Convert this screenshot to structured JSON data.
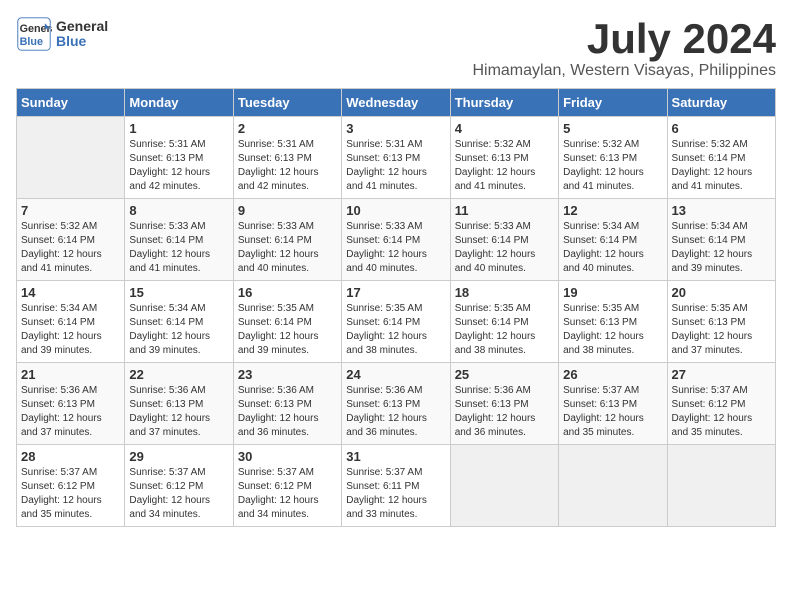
{
  "logo": {
    "line1": "General",
    "line2": "Blue"
  },
  "title": "July 2024",
  "subtitle": "Himamaylan, Western Visayas, Philippines",
  "days_header": [
    "Sunday",
    "Monday",
    "Tuesday",
    "Wednesday",
    "Thursday",
    "Friday",
    "Saturday"
  ],
  "weeks": [
    [
      {
        "day": "",
        "sunrise": "",
        "sunset": "",
        "daylight": ""
      },
      {
        "day": "1",
        "sunrise": "Sunrise: 5:31 AM",
        "sunset": "Sunset: 6:13 PM",
        "daylight": "Daylight: 12 hours and 42 minutes."
      },
      {
        "day": "2",
        "sunrise": "Sunrise: 5:31 AM",
        "sunset": "Sunset: 6:13 PM",
        "daylight": "Daylight: 12 hours and 42 minutes."
      },
      {
        "day": "3",
        "sunrise": "Sunrise: 5:31 AM",
        "sunset": "Sunset: 6:13 PM",
        "daylight": "Daylight: 12 hours and 41 minutes."
      },
      {
        "day": "4",
        "sunrise": "Sunrise: 5:32 AM",
        "sunset": "Sunset: 6:13 PM",
        "daylight": "Daylight: 12 hours and 41 minutes."
      },
      {
        "day": "5",
        "sunrise": "Sunrise: 5:32 AM",
        "sunset": "Sunset: 6:13 PM",
        "daylight": "Daylight: 12 hours and 41 minutes."
      },
      {
        "day": "6",
        "sunrise": "Sunrise: 5:32 AM",
        "sunset": "Sunset: 6:14 PM",
        "daylight": "Daylight: 12 hours and 41 minutes."
      }
    ],
    [
      {
        "day": "7",
        "sunrise": "Sunrise: 5:32 AM",
        "sunset": "Sunset: 6:14 PM",
        "daylight": "Daylight: 12 hours and 41 minutes."
      },
      {
        "day": "8",
        "sunrise": "Sunrise: 5:33 AM",
        "sunset": "Sunset: 6:14 PM",
        "daylight": "Daylight: 12 hours and 41 minutes."
      },
      {
        "day": "9",
        "sunrise": "Sunrise: 5:33 AM",
        "sunset": "Sunset: 6:14 PM",
        "daylight": "Daylight: 12 hours and 40 minutes."
      },
      {
        "day": "10",
        "sunrise": "Sunrise: 5:33 AM",
        "sunset": "Sunset: 6:14 PM",
        "daylight": "Daylight: 12 hours and 40 minutes."
      },
      {
        "day": "11",
        "sunrise": "Sunrise: 5:33 AM",
        "sunset": "Sunset: 6:14 PM",
        "daylight": "Daylight: 12 hours and 40 minutes."
      },
      {
        "day": "12",
        "sunrise": "Sunrise: 5:34 AM",
        "sunset": "Sunset: 6:14 PM",
        "daylight": "Daylight: 12 hours and 40 minutes."
      },
      {
        "day": "13",
        "sunrise": "Sunrise: 5:34 AM",
        "sunset": "Sunset: 6:14 PM",
        "daylight": "Daylight: 12 hours and 39 minutes."
      }
    ],
    [
      {
        "day": "14",
        "sunrise": "Sunrise: 5:34 AM",
        "sunset": "Sunset: 6:14 PM",
        "daylight": "Daylight: 12 hours and 39 minutes."
      },
      {
        "day": "15",
        "sunrise": "Sunrise: 5:34 AM",
        "sunset": "Sunset: 6:14 PM",
        "daylight": "Daylight: 12 hours and 39 minutes."
      },
      {
        "day": "16",
        "sunrise": "Sunrise: 5:35 AM",
        "sunset": "Sunset: 6:14 PM",
        "daylight": "Daylight: 12 hours and 39 minutes."
      },
      {
        "day": "17",
        "sunrise": "Sunrise: 5:35 AM",
        "sunset": "Sunset: 6:14 PM",
        "daylight": "Daylight: 12 hours and 38 minutes."
      },
      {
        "day": "18",
        "sunrise": "Sunrise: 5:35 AM",
        "sunset": "Sunset: 6:14 PM",
        "daylight": "Daylight: 12 hours and 38 minutes."
      },
      {
        "day": "19",
        "sunrise": "Sunrise: 5:35 AM",
        "sunset": "Sunset: 6:13 PM",
        "daylight": "Daylight: 12 hours and 38 minutes."
      },
      {
        "day": "20",
        "sunrise": "Sunrise: 5:35 AM",
        "sunset": "Sunset: 6:13 PM",
        "daylight": "Daylight: 12 hours and 37 minutes."
      }
    ],
    [
      {
        "day": "21",
        "sunrise": "Sunrise: 5:36 AM",
        "sunset": "Sunset: 6:13 PM",
        "daylight": "Daylight: 12 hours and 37 minutes."
      },
      {
        "day": "22",
        "sunrise": "Sunrise: 5:36 AM",
        "sunset": "Sunset: 6:13 PM",
        "daylight": "Daylight: 12 hours and 37 minutes."
      },
      {
        "day": "23",
        "sunrise": "Sunrise: 5:36 AM",
        "sunset": "Sunset: 6:13 PM",
        "daylight": "Daylight: 12 hours and 36 minutes."
      },
      {
        "day": "24",
        "sunrise": "Sunrise: 5:36 AM",
        "sunset": "Sunset: 6:13 PM",
        "daylight": "Daylight: 12 hours and 36 minutes."
      },
      {
        "day": "25",
        "sunrise": "Sunrise: 5:36 AM",
        "sunset": "Sunset: 6:13 PM",
        "daylight": "Daylight: 12 hours and 36 minutes."
      },
      {
        "day": "26",
        "sunrise": "Sunrise: 5:37 AM",
        "sunset": "Sunset: 6:13 PM",
        "daylight": "Daylight: 12 hours and 35 minutes."
      },
      {
        "day": "27",
        "sunrise": "Sunrise: 5:37 AM",
        "sunset": "Sunset: 6:12 PM",
        "daylight": "Daylight: 12 hours and 35 minutes."
      }
    ],
    [
      {
        "day": "28",
        "sunrise": "Sunrise: 5:37 AM",
        "sunset": "Sunset: 6:12 PM",
        "daylight": "Daylight: 12 hours and 35 minutes."
      },
      {
        "day": "29",
        "sunrise": "Sunrise: 5:37 AM",
        "sunset": "Sunset: 6:12 PM",
        "daylight": "Daylight: 12 hours and 34 minutes."
      },
      {
        "day": "30",
        "sunrise": "Sunrise: 5:37 AM",
        "sunset": "Sunset: 6:12 PM",
        "daylight": "Daylight: 12 hours and 34 minutes."
      },
      {
        "day": "31",
        "sunrise": "Sunrise: 5:37 AM",
        "sunset": "Sunset: 6:11 PM",
        "daylight": "Daylight: 12 hours and 33 minutes."
      },
      {
        "day": "",
        "sunrise": "",
        "sunset": "",
        "daylight": ""
      },
      {
        "day": "",
        "sunrise": "",
        "sunset": "",
        "daylight": ""
      },
      {
        "day": "",
        "sunrise": "",
        "sunset": "",
        "daylight": ""
      }
    ]
  ]
}
